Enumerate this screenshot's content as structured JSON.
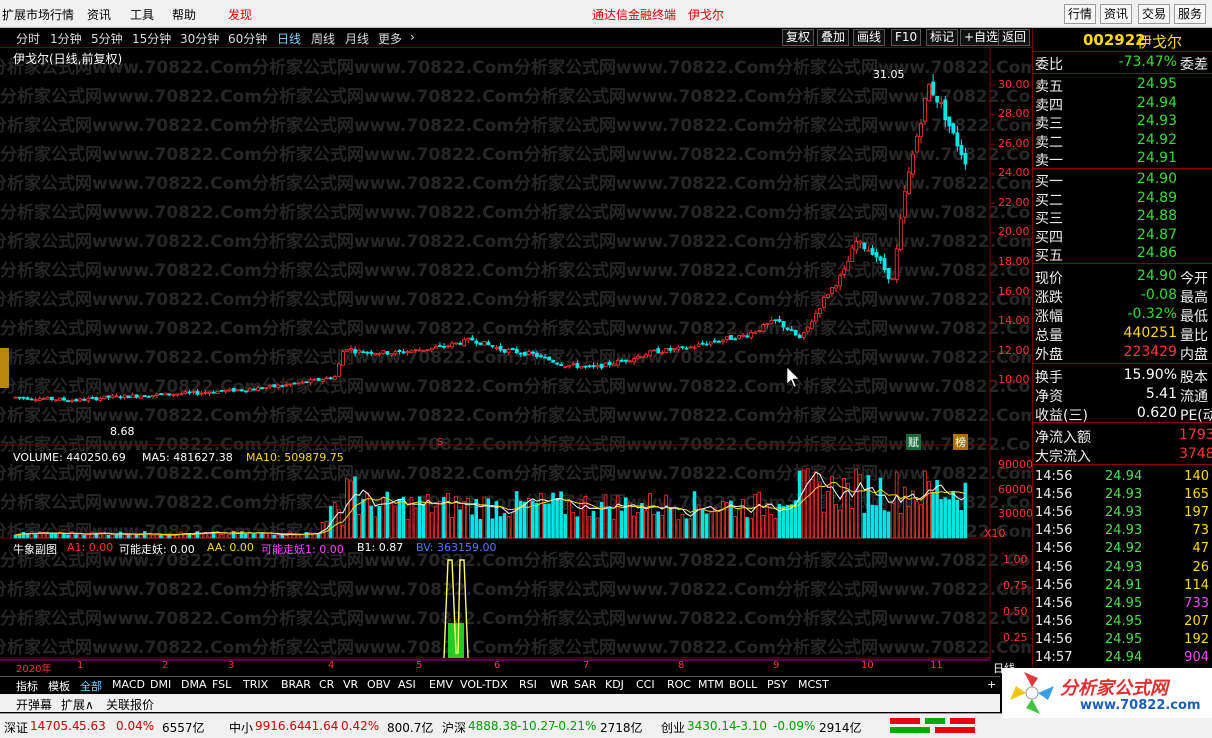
{
  "menu": {
    "items": [
      "扩展市场行情",
      "资讯",
      "工具",
      "帮助"
    ],
    "discover": "发现",
    "center_title": "通达信金融终端",
    "center_name": "伊戈尔",
    "right_buttons": [
      "行情",
      "资讯",
      "交易",
      "服务"
    ]
  },
  "periods": {
    "items": [
      "分时",
      "1分钟",
      "5分钟",
      "15分钟",
      "30分钟",
      "60分钟",
      "日线",
      "周线",
      "月线",
      "更多"
    ],
    "active": "日线",
    "more_arrow": "›",
    "tools": [
      "复权",
      "叠加",
      "画线",
      "F10",
      "标记",
      "+自选",
      "返回"
    ]
  },
  "main_chart": {
    "title": "伊戈尔(日线,前复权)",
    "high_label": "31.05",
    "low_label": "8.68",
    "price_axis": [
      "30.00",
      "28.00",
      "26.00",
      "24.00",
      "22.00",
      "20.00",
      "18.00",
      "16.00",
      "14.00",
      "12.00",
      "10.00"
    ],
    "badges": [
      "赋",
      "榜"
    ],
    "marker": "S"
  },
  "volume_chart": {
    "vol_label": "VOLUME: 440250.69",
    "ma5": "MA5: 481627.38",
    "ma10": "MA10: 509879.75",
    "axis": [
      "90000",
      "60000",
      "30000"
    ],
    "unit": "X10"
  },
  "sub_chart": {
    "name": "牛象副图",
    "a1": "A1: 0.00",
    "kny": "可能走妖: 0.00",
    "aa": "AA: 0.00",
    "kny1": "可能走妖1: 0.00",
    "b1": "B1: 0.87",
    "bv": "BV: 363159.00",
    "axis": [
      "1.00",
      "0.75",
      "0.50",
      "0.25"
    ]
  },
  "date_axis": {
    "year": "2020年",
    "months": [
      "1",
      "2",
      "3",
      "4",
      "5",
      "6",
      "7",
      "8",
      "9",
      "10",
      "11"
    ],
    "period": "日线"
  },
  "watermark": {
    "a": "分析家公式网www.70822.Com",
    "b": "82.Com"
  },
  "quote": {
    "code": "002922",
    "name": "伊戈尔",
    "weibi": {
      "label": "委比",
      "value": "-73.47%",
      "label2": "委差"
    },
    "sells": [
      {
        "label": "卖五",
        "price": "24.95"
      },
      {
        "label": "卖四",
        "price": "24.94"
      },
      {
        "label": "卖三",
        "price": "24.93"
      },
      {
        "label": "卖二",
        "price": "24.92"
      },
      {
        "label": "卖一",
        "price": "24.91"
      }
    ],
    "buys": [
      {
        "label": "买一",
        "price": "24.90"
      },
      {
        "label": "买二",
        "price": "24.89"
      },
      {
        "label": "买三",
        "price": "24.88"
      },
      {
        "label": "买四",
        "price": "24.87"
      },
      {
        "label": "买五",
        "price": "24.86"
      }
    ],
    "stats": [
      {
        "label": "现价",
        "value": "24.90",
        "label2": "今开",
        "color": "dn"
      },
      {
        "label": "涨跌",
        "value": "-0.08",
        "label2": "最高",
        "color": "dn"
      },
      {
        "label": "涨幅",
        "value": "-0.32%",
        "label2": "最低",
        "color": "dn"
      },
      {
        "label": "总量",
        "value": "440251",
        "label2": "量比",
        "color": "yl"
      },
      {
        "label": "外盘",
        "value": "223429",
        "label2": "内盘",
        "color": "up"
      }
    ],
    "stats2": [
      {
        "label": "换手",
        "value": "15.90%",
        "label2": "股本"
      },
      {
        "label": "净资",
        "value": "5.41",
        "label2": "流通"
      },
      {
        "label": "收益(三)",
        "value": "0.620",
        "label2": "PE(动)"
      }
    ],
    "flows": [
      {
        "label": "净流入额",
        "value": "1793"
      },
      {
        "label": "大宗流入",
        "value": "3748"
      }
    ],
    "ticks": [
      {
        "t": "14:56",
        "p": "24.94",
        "v": "140"
      },
      {
        "t": "14:56",
        "p": "24.93",
        "v": "165"
      },
      {
        "t": "14:56",
        "p": "24.93",
        "v": "197"
      },
      {
        "t": "14:56",
        "p": "24.93",
        "v": "73"
      },
      {
        "t": "14:56",
        "p": "24.92",
        "v": "47"
      },
      {
        "t": "14:56",
        "p": "24.93",
        "v": "26"
      },
      {
        "t": "14:56",
        "p": "24.91",
        "v": "114"
      },
      {
        "t": "14:56",
        "p": "24.95",
        "v": "733"
      },
      {
        "t": "14:56",
        "p": "24.95",
        "v": "207"
      },
      {
        "t": "14:56",
        "p": "24.95",
        "v": "192"
      },
      {
        "t": "14:57",
        "p": "24.94",
        "v": "904"
      }
    ]
  },
  "tabs": {
    "items": [
      "指标",
      "模板",
      "全部",
      "MACD",
      "DMI",
      "DMA",
      "FSL",
      "TRIX",
      "BRAR",
      "CR",
      "VR",
      "OBV",
      "ASI",
      "EMV",
      "VOL-TDX",
      "RSI",
      "WR",
      "SAR",
      "KDJ",
      "CCI",
      "ROC",
      "MTM",
      "BOLL",
      "PSY",
      "MCST"
    ],
    "plus": "+"
  },
  "subtabs": {
    "items": [
      "开弹幕",
      "扩展∧",
      "关联报价"
    ]
  },
  "status": [
    {
      "name": "深证",
      "val": "14705.4",
      "chg": "5.63",
      "pct": "0.04%",
      "amt": "6557亿"
    },
    {
      "name": "中小",
      "val": "9916.64",
      "chg": "41.64",
      "pct": "0.42%",
      "amt": "800.7亿"
    },
    {
      "name": "沪深",
      "val": "4888.38",
      "chg": "-10.27",
      "pct": "-0.21%",
      "amt": "2718亿"
    },
    {
      "name": "创业",
      "val": "3430.14",
      "chg": "-3.10",
      "pct": "-0.09%",
      "amt": "2914亿"
    }
  ],
  "logo": {
    "cn": "分析家公式网",
    "url": "www.70822.com"
  },
  "colors": {
    "up": "#ff3333",
    "down": "#00e5e5",
    "bg": "#000000",
    "grid": "#7a0000",
    "ma5": "#ffffff",
    "ma10": "#ffd800"
  }
}
